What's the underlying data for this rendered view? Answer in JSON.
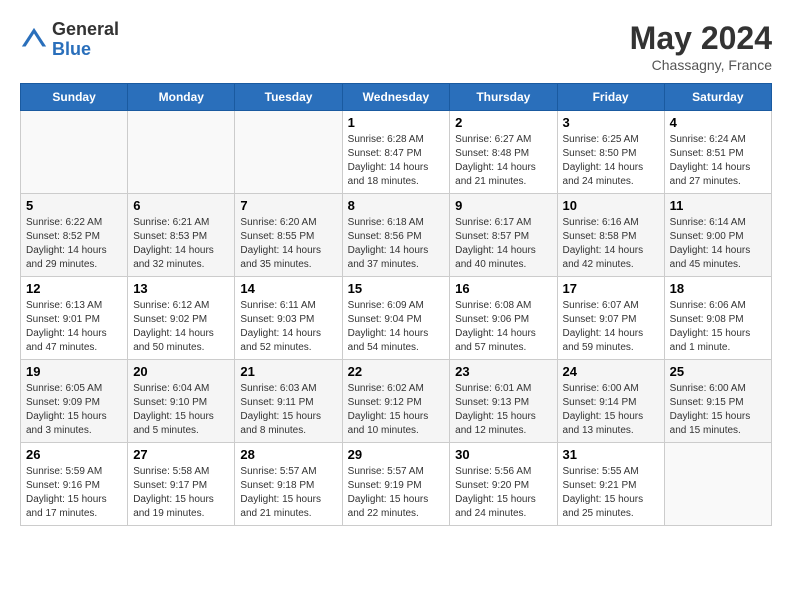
{
  "header": {
    "logo_general": "General",
    "logo_blue": "Blue",
    "month_year": "May 2024",
    "location": "Chassagny, France"
  },
  "days_of_week": [
    "Sunday",
    "Monday",
    "Tuesday",
    "Wednesday",
    "Thursday",
    "Friday",
    "Saturday"
  ],
  "weeks": [
    [
      {
        "day": "",
        "info": ""
      },
      {
        "day": "",
        "info": ""
      },
      {
        "day": "",
        "info": ""
      },
      {
        "day": "1",
        "info": "Sunrise: 6:28 AM\nSunset: 8:47 PM\nDaylight: 14 hours and 18 minutes."
      },
      {
        "day": "2",
        "info": "Sunrise: 6:27 AM\nSunset: 8:48 PM\nDaylight: 14 hours and 21 minutes."
      },
      {
        "day": "3",
        "info": "Sunrise: 6:25 AM\nSunset: 8:50 PM\nDaylight: 14 hours and 24 minutes."
      },
      {
        "day": "4",
        "info": "Sunrise: 6:24 AM\nSunset: 8:51 PM\nDaylight: 14 hours and 27 minutes."
      }
    ],
    [
      {
        "day": "5",
        "info": "Sunrise: 6:22 AM\nSunset: 8:52 PM\nDaylight: 14 hours and 29 minutes."
      },
      {
        "day": "6",
        "info": "Sunrise: 6:21 AM\nSunset: 8:53 PM\nDaylight: 14 hours and 32 minutes."
      },
      {
        "day": "7",
        "info": "Sunrise: 6:20 AM\nSunset: 8:55 PM\nDaylight: 14 hours and 35 minutes."
      },
      {
        "day": "8",
        "info": "Sunrise: 6:18 AM\nSunset: 8:56 PM\nDaylight: 14 hours and 37 minutes."
      },
      {
        "day": "9",
        "info": "Sunrise: 6:17 AM\nSunset: 8:57 PM\nDaylight: 14 hours and 40 minutes."
      },
      {
        "day": "10",
        "info": "Sunrise: 6:16 AM\nSunset: 8:58 PM\nDaylight: 14 hours and 42 minutes."
      },
      {
        "day": "11",
        "info": "Sunrise: 6:14 AM\nSunset: 9:00 PM\nDaylight: 14 hours and 45 minutes."
      }
    ],
    [
      {
        "day": "12",
        "info": "Sunrise: 6:13 AM\nSunset: 9:01 PM\nDaylight: 14 hours and 47 minutes."
      },
      {
        "day": "13",
        "info": "Sunrise: 6:12 AM\nSunset: 9:02 PM\nDaylight: 14 hours and 50 minutes."
      },
      {
        "day": "14",
        "info": "Sunrise: 6:11 AM\nSunset: 9:03 PM\nDaylight: 14 hours and 52 minutes."
      },
      {
        "day": "15",
        "info": "Sunrise: 6:09 AM\nSunset: 9:04 PM\nDaylight: 14 hours and 54 minutes."
      },
      {
        "day": "16",
        "info": "Sunrise: 6:08 AM\nSunset: 9:06 PM\nDaylight: 14 hours and 57 minutes."
      },
      {
        "day": "17",
        "info": "Sunrise: 6:07 AM\nSunset: 9:07 PM\nDaylight: 14 hours and 59 minutes."
      },
      {
        "day": "18",
        "info": "Sunrise: 6:06 AM\nSunset: 9:08 PM\nDaylight: 15 hours and 1 minute."
      }
    ],
    [
      {
        "day": "19",
        "info": "Sunrise: 6:05 AM\nSunset: 9:09 PM\nDaylight: 15 hours and 3 minutes."
      },
      {
        "day": "20",
        "info": "Sunrise: 6:04 AM\nSunset: 9:10 PM\nDaylight: 15 hours and 5 minutes."
      },
      {
        "day": "21",
        "info": "Sunrise: 6:03 AM\nSunset: 9:11 PM\nDaylight: 15 hours and 8 minutes."
      },
      {
        "day": "22",
        "info": "Sunrise: 6:02 AM\nSunset: 9:12 PM\nDaylight: 15 hours and 10 minutes."
      },
      {
        "day": "23",
        "info": "Sunrise: 6:01 AM\nSunset: 9:13 PM\nDaylight: 15 hours and 12 minutes."
      },
      {
        "day": "24",
        "info": "Sunrise: 6:00 AM\nSunset: 9:14 PM\nDaylight: 15 hours and 13 minutes."
      },
      {
        "day": "25",
        "info": "Sunrise: 6:00 AM\nSunset: 9:15 PM\nDaylight: 15 hours and 15 minutes."
      }
    ],
    [
      {
        "day": "26",
        "info": "Sunrise: 5:59 AM\nSunset: 9:16 PM\nDaylight: 15 hours and 17 minutes."
      },
      {
        "day": "27",
        "info": "Sunrise: 5:58 AM\nSunset: 9:17 PM\nDaylight: 15 hours and 19 minutes."
      },
      {
        "day": "28",
        "info": "Sunrise: 5:57 AM\nSunset: 9:18 PM\nDaylight: 15 hours and 21 minutes."
      },
      {
        "day": "29",
        "info": "Sunrise: 5:57 AM\nSunset: 9:19 PM\nDaylight: 15 hours and 22 minutes."
      },
      {
        "day": "30",
        "info": "Sunrise: 5:56 AM\nSunset: 9:20 PM\nDaylight: 15 hours and 24 minutes."
      },
      {
        "day": "31",
        "info": "Sunrise: 5:55 AM\nSunset: 9:21 PM\nDaylight: 15 hours and 25 minutes."
      },
      {
        "day": "",
        "info": ""
      }
    ]
  ]
}
